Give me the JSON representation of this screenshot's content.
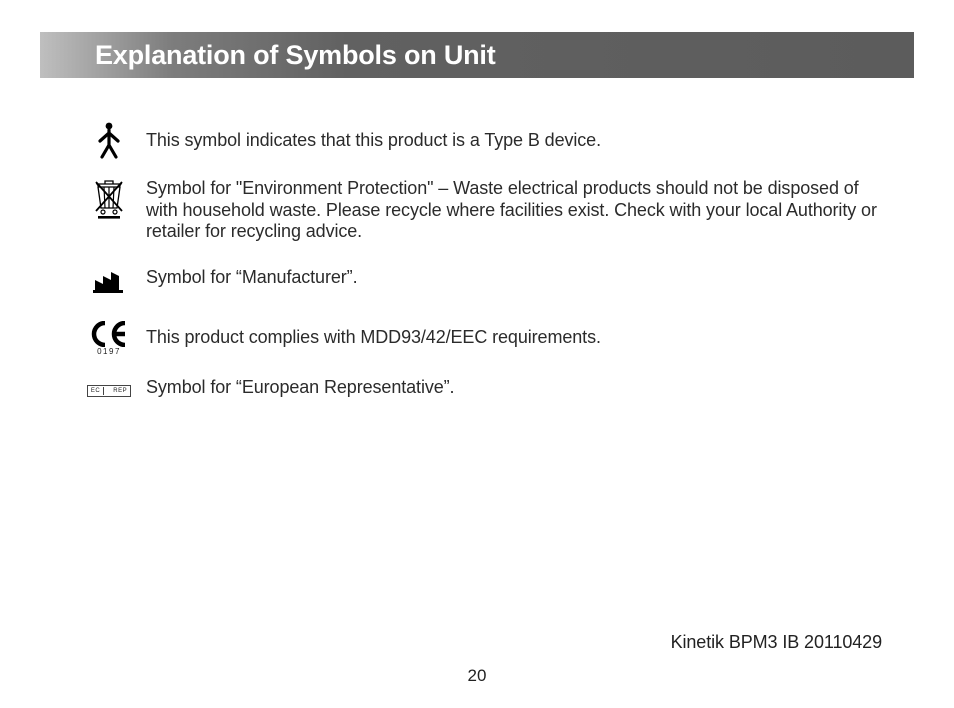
{
  "title": "Explanation of Symbols on Unit",
  "symbols": [
    {
      "icon": "type-b-icon",
      "desc": "This symbol indicates that this product is a Type B device."
    },
    {
      "icon": "weee-icon",
      "desc": "Symbol for \"Environment Protection\" – Waste electrical products should not be disposed of with household waste. Please recycle where facilities exist. Check with your local Authority or retailer for recycling advice."
    },
    {
      "icon": "manufacturer-icon",
      "desc": "Symbol for “Manufacturer”."
    },
    {
      "icon": "ce-mark-icon",
      "desc": "This product complies with MDD93/42/EEC requirements.",
      "ce_number": "0197"
    },
    {
      "icon": "ec-rep-icon",
      "desc": "Symbol for “European Representative”.",
      "ec_left": "EC",
      "ec_right": "REP"
    }
  ],
  "footer_code": "Kinetik BPM3 IB 20110429",
  "page_number": "20"
}
